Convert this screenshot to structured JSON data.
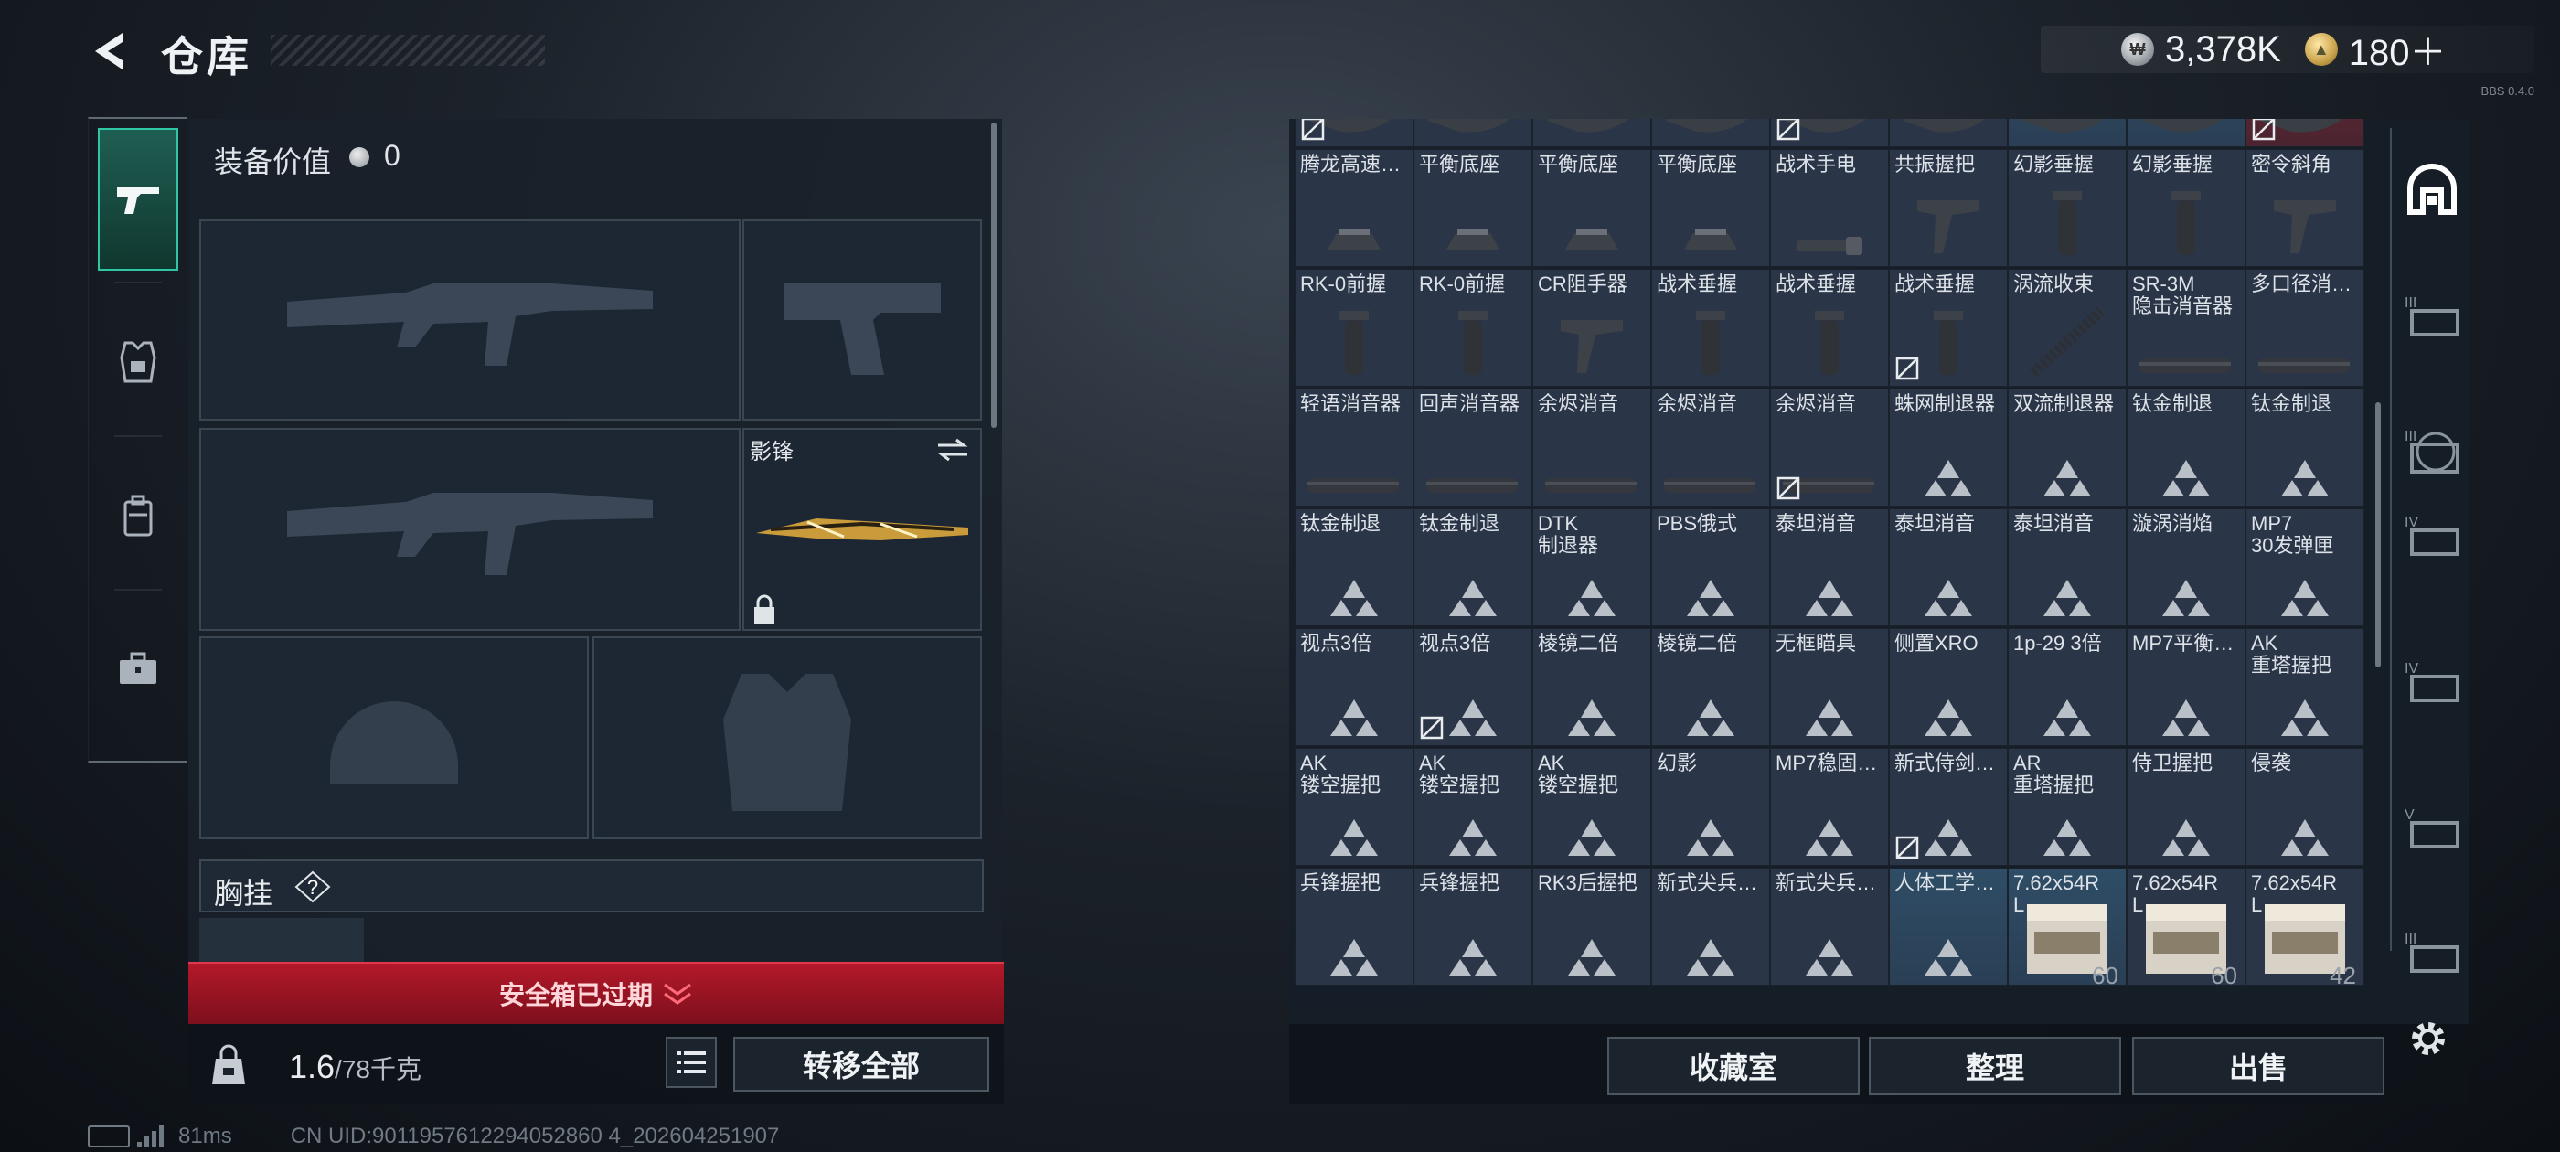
{
  "header": {
    "title": "仓库"
  },
  "currency": {
    "silver": "3,378K",
    "gold": "180＋"
  },
  "version": "BBS 0.4.0",
  "loadout": {
    "equipment_value_label": "装备价值",
    "equipment_value": "0",
    "melee_label": "影锋",
    "chest_rig_label": "胸挂",
    "chest_rig_help": "?"
  },
  "safe_box": {
    "expired_text": "安全箱已过期"
  },
  "weight": {
    "current": "1.6",
    "max": "/78千克"
  },
  "buttons": {
    "transfer_all": "转移全部",
    "collection": "收藏室",
    "sort": "整理",
    "sell": "出售"
  },
  "status": {
    "ping": "81ms",
    "uid": "CN UID:9011957612294052860 4_202604251907"
  },
  "stash": {
    "rows": [
      [
        {
          "n": "",
          "i": "mag",
          "u": true
        },
        {
          "n": "",
          "i": "mag"
        },
        {
          "n": "",
          "i": "mag"
        },
        {
          "n": "",
          "i": "mag"
        },
        {
          "n": "",
          "i": "mag",
          "u": true
        },
        {
          "n": "",
          "i": "mag"
        },
        {
          "n": "",
          "i": "mag",
          "h": "blue"
        },
        {
          "n": "",
          "i": "mag",
          "h": "blue"
        },
        {
          "n": "",
          "i": "mag",
          "h": "red",
          "u": true
        }
      ],
      [
        {
          "n": "腾龙高速…",
          "i": "mount"
        },
        {
          "n": "平衡底座",
          "i": "mount"
        },
        {
          "n": "平衡底座",
          "i": "mount"
        },
        {
          "n": "平衡底座",
          "i": "mount"
        },
        {
          "n": "战术手电",
          "i": "light"
        },
        {
          "n": "共振握把",
          "i": "angled"
        },
        {
          "n": "幻影垂握",
          "i": "grip"
        },
        {
          "n": "幻影垂握",
          "i": "grip"
        },
        {
          "n": "密令斜角",
          "i": "angled"
        }
      ],
      [
        {
          "n": "RK-0前握",
          "i": "grip"
        },
        {
          "n": "RK-0前握",
          "i": "grip"
        },
        {
          "n": "CR阻手器",
          "i": "angled"
        },
        {
          "n": "战术垂握",
          "i": "grip"
        },
        {
          "n": "战术垂握",
          "i": "grip"
        },
        {
          "n": "战术垂握",
          "i": "grip",
          "u": true
        },
        {
          "n": "涡流收束",
          "i": "spring"
        },
        {
          "n": "SR-3M\n隐击消音器",
          "i": "supp"
        },
        {
          "n": "多口径消…",
          "i": "supp"
        }
      ],
      [
        {
          "n": "轻语消音器",
          "i": "supp"
        },
        {
          "n": "回声消音器",
          "i": "supp"
        },
        {
          "n": "余烬消音",
          "i": "supp"
        },
        {
          "n": "余烬消音",
          "i": "supp"
        },
        {
          "n": "余烬消音",
          "i": "supp",
          "u": true
        },
        {
          "n": "蛛网制退器",
          "i": "tri"
        },
        {
          "n": "双流制退器",
          "i": "tri"
        },
        {
          "n": "钛金制退",
          "i": "tri"
        },
        {
          "n": "钛金制退",
          "i": "tri"
        }
      ],
      [
        {
          "n": "钛金制退",
          "i": "tri"
        },
        {
          "n": "钛金制退",
          "i": "tri"
        },
        {
          "n": "DTK\n制退器",
          "i": "tri"
        },
        {
          "n": "PBS俄式",
          "i": "tri"
        },
        {
          "n": "泰坦消音",
          "i": "tri"
        },
        {
          "n": "泰坦消音",
          "i": "tri"
        },
        {
          "n": "泰坦消音",
          "i": "tri"
        },
        {
          "n": "漩涡消焰",
          "i": "tri"
        },
        {
          "n": "MP7\n30发弹匣",
          "i": "tri"
        }
      ],
      [
        {
          "n": "视点3倍",
          "i": "tri"
        },
        {
          "n": "视点3倍",
          "i": "tri",
          "u": true
        },
        {
          "n": "棱镜二倍",
          "i": "tri"
        },
        {
          "n": "棱镜二倍",
          "i": "tri"
        },
        {
          "n": "无框瞄具",
          "i": "tri"
        },
        {
          "n": "侧置XRO",
          "i": "tri"
        },
        {
          "n": "1p-29 3倍",
          "i": "tri"
        },
        {
          "n": "MP7平衡…",
          "i": "tri"
        },
        {
          "n": "AK\n重塔握把",
          "i": "tri"
        }
      ],
      [
        {
          "n": "AK\n镂空握把",
          "i": "tri"
        },
        {
          "n": "AK\n镂空握把",
          "i": "tri"
        },
        {
          "n": "AK\n镂空握把",
          "i": "tri"
        },
        {
          "n": "幻影",
          "i": "tri"
        },
        {
          "n": "MP7稳固…",
          "i": "tri"
        },
        {
          "n": "新式侍剑…",
          "i": "tri",
          "u": true
        },
        {
          "n": "AR\n重塔握把",
          "i": "tri"
        },
        {
          "n": "侍卫握把",
          "i": "tri"
        },
        {
          "n": "侵袭",
          "i": "tri"
        }
      ],
      [
        {
          "n": "兵锋握把",
          "i": "tri"
        },
        {
          "n": "兵锋握把",
          "i": "tri"
        },
        {
          "n": "RK3后握把",
          "i": "tri"
        },
        {
          "n": "新式尖兵…",
          "i": "tri"
        },
        {
          "n": "新式尖兵…",
          "i": "tri"
        },
        {
          "n": "人体工学…",
          "i": "tri",
          "h": "blue"
        },
        {
          "n": "7.62x54R\nL",
          "i": "ammo",
          "q": "60",
          "h": "blue"
        },
        {
          "n": "7.62x54R\nL",
          "i": "ammo",
          "q": "60"
        },
        {
          "n": "7.62x54R\nL",
          "i": "ammo",
          "q": "42"
        }
      ]
    ]
  }
}
